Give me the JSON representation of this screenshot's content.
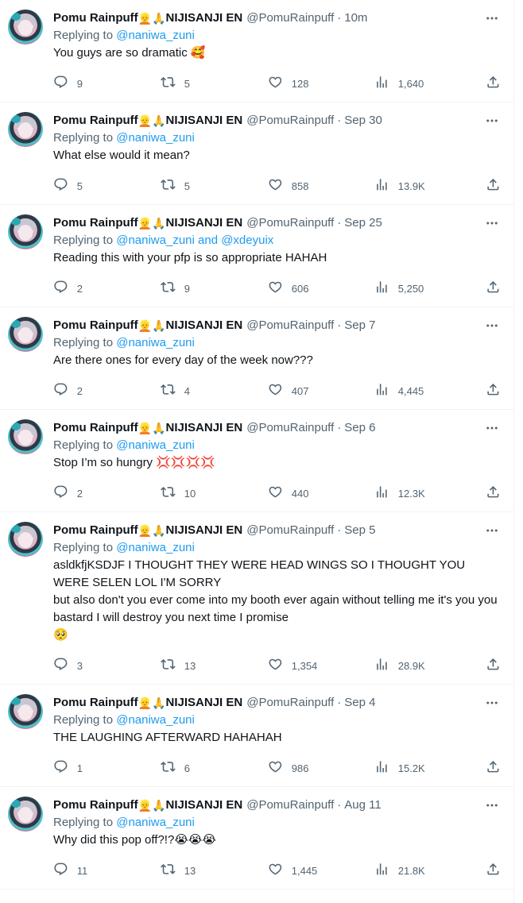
{
  "user": {
    "display_name": "Pomu Rainpuff",
    "suffix": "NIJISANJI EN",
    "handle": "@PomuRainpuff"
  },
  "icons": {
    "reply": "reply-icon",
    "retweet": "retweet-icon",
    "like": "heart-icon",
    "views": "views-icon",
    "share": "share-icon",
    "more": "more-icon"
  },
  "colors": {
    "link": "#1d9bf0",
    "secondary_text": "#536471",
    "primary_text": "#0f1419",
    "divider": "#eff3f4"
  },
  "tweets": [
    {
      "time": "10m",
      "replying_prefix": "Replying to ",
      "replying_to": "@naniwa_zuni",
      "text": "You guys are so dramatic 🥰",
      "replies": "9",
      "retweets": "5",
      "likes": "128",
      "views": "1,640"
    },
    {
      "time": "Sep 30",
      "replying_prefix": "Replying to ",
      "replying_to": "@naniwa_zuni",
      "text": "What else would it mean?",
      "replies": "5",
      "retweets": "5",
      "likes": "858",
      "views": "13.9K"
    },
    {
      "time": "Sep 25",
      "replying_prefix": "Replying to ",
      "replying_to": "@naniwa_zuni and @xdeyuix",
      "text": "Reading this with your pfp is so appropriate HAHAH",
      "replies": "2",
      "retweets": "9",
      "likes": "606",
      "views": "5,250"
    },
    {
      "time": "Sep 7",
      "replying_prefix": "Replying to ",
      "replying_to": "@naniwa_zuni",
      "text": "Are there ones for every day of the week now???",
      "replies": "2",
      "retweets": "4",
      "likes": "407",
      "views": "4,445"
    },
    {
      "time": "Sep 6",
      "replying_prefix": "Replying to ",
      "replying_to": "@naniwa_zuni",
      "text": "Stop I’m so hungry 💢💢💢💢",
      "replies": "2",
      "retweets": "10",
      "likes": "440",
      "views": "12.3K"
    },
    {
      "time": "Sep 5",
      "replying_prefix": "Replying to ",
      "replying_to": "@naniwa_zuni",
      "text": "asldkfjKSDJF I THOUGHT THEY WERE HEAD WINGS SO I THOUGHT YOU WERE SELEN LOL I'M SORRY\nbut also don't you ever come into my booth ever again without telling me it's you you bastard I will destroy you next time I promise\n🥺",
      "replies": "3",
      "retweets": "13",
      "likes": "1,354",
      "views": "28.9K"
    },
    {
      "time": "Sep 4",
      "replying_prefix": "Replying to ",
      "replying_to": "@naniwa_zuni",
      "text": "THE LAUGHING AFTERWARD HAHAHAH",
      "replies": "1",
      "retweets": "6",
      "likes": "986",
      "views": "15.2K"
    },
    {
      "time": "Aug 11",
      "replying_prefix": "Replying to ",
      "replying_to": "@naniwa_zuni",
      "text": "Why did this pop off?!?😭😭😭",
      "replies": "11",
      "retweets": "13",
      "likes": "1,445",
      "views": "21.8K"
    }
  ]
}
